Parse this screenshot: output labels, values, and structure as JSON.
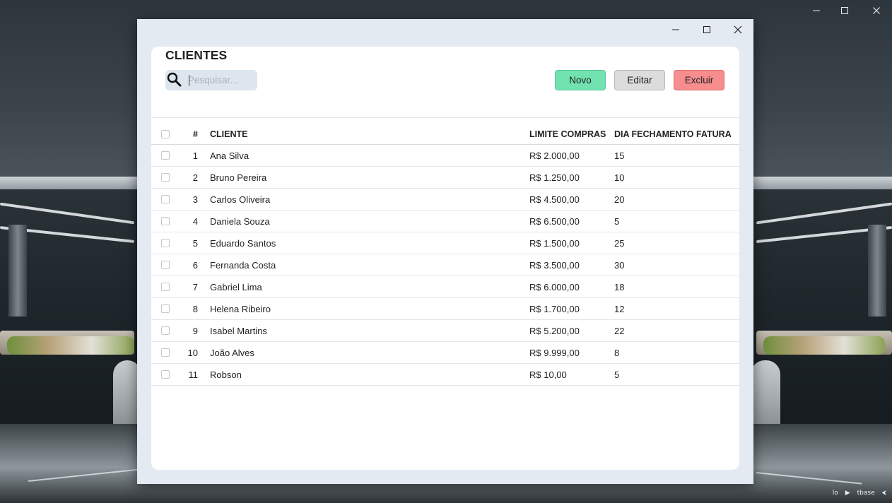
{
  "desktop": {
    "tray": [
      "lo",
      "▶",
      "tbase",
      "⮜"
    ]
  },
  "window": {
    "controls": {
      "minimize_icon": "minimize-icon",
      "maximize_icon": "maximize-icon",
      "close_icon": "close-icon"
    }
  },
  "page": {
    "title": "CLIENTES"
  },
  "search": {
    "icon": "search-icon",
    "placeholder": "Pesquisar...",
    "value": ""
  },
  "toolbar": {
    "novo_label": "Novo",
    "editar_label": "Editar",
    "excluir_label": "Excluir"
  },
  "colors": {
    "novo": "#72e2b1",
    "editar": "#dcdcdc",
    "excluir": "#f78d8d",
    "window_bg": "#e4eaf1",
    "search_bg": "#dde5ee"
  },
  "table": {
    "headers": {
      "num": "#",
      "cliente": "CLIENTE",
      "limite": "LIMITE COMPRAS",
      "dia": "DIA FECHAMENTO FATURA"
    },
    "rows": [
      {
        "num": "1",
        "cliente": "Ana Silva",
        "limite": "R$ 2.000,00",
        "dia": "15"
      },
      {
        "num": "2",
        "cliente": "Bruno Pereira",
        "limite": "R$ 1.250,00",
        "dia": "10"
      },
      {
        "num": "3",
        "cliente": "Carlos Oliveira",
        "limite": "R$ 4.500,00",
        "dia": "20"
      },
      {
        "num": "4",
        "cliente": "Daniela Souza",
        "limite": "R$ 6.500,00",
        "dia": "5"
      },
      {
        "num": "5",
        "cliente": "Eduardo Santos",
        "limite": "R$ 1.500,00",
        "dia": "25"
      },
      {
        "num": "6",
        "cliente": "Fernanda Costa",
        "limite": "R$ 3.500,00",
        "dia": "30"
      },
      {
        "num": "7",
        "cliente": "Gabriel Lima",
        "limite": "R$ 6.000,00",
        "dia": "18"
      },
      {
        "num": "8",
        "cliente": "Helena Ribeiro",
        "limite": "R$ 1.700,00",
        "dia": "12"
      },
      {
        "num": "9",
        "cliente": "Isabel Martins",
        "limite": "R$ 5.200,00",
        "dia": "22"
      },
      {
        "num": "10",
        "cliente": "João Alves",
        "limite": "R$ 9.999,00",
        "dia": "8"
      },
      {
        "num": "11",
        "cliente": "Robson",
        "limite": "R$ 10,00",
        "dia": "5"
      }
    ]
  }
}
